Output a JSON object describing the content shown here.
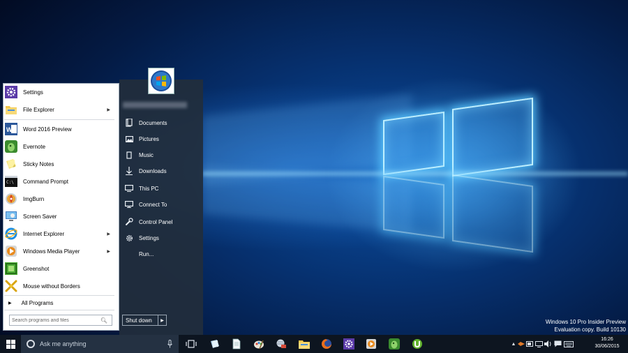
{
  "start_menu": {
    "programs": [
      {
        "label": "Settings",
        "icon": "gear-icon",
        "has_submenu": false
      },
      {
        "label": "File Explorer",
        "icon": "folder-icon",
        "has_submenu": true
      },
      {
        "label": "Word 2016 Preview",
        "icon": "word-icon",
        "has_submenu": false
      },
      {
        "label": "Evernote",
        "icon": "evernote-icon",
        "has_submenu": false
      },
      {
        "label": "Sticky Notes",
        "icon": "sticky-notes-icon",
        "has_submenu": false
      },
      {
        "label": "Command Prompt",
        "icon": "command-prompt-icon",
        "has_submenu": false
      },
      {
        "label": "ImgBurn",
        "icon": "imgburn-icon",
        "has_submenu": false
      },
      {
        "label": "Screen Saver",
        "icon": "screen-saver-icon",
        "has_submenu": false
      },
      {
        "label": "Internet Explorer",
        "icon": "internet-explorer-icon",
        "has_submenu": true
      },
      {
        "label": "Windows Media Player",
        "icon": "media-player-icon",
        "has_submenu": true
      },
      {
        "label": "Greenshot",
        "icon": "greenshot-icon",
        "has_submenu": false
      },
      {
        "label": "Mouse without Borders",
        "icon": "mouse-without-borders-icon",
        "has_submenu": false
      }
    ],
    "all_programs_label": "All Programs",
    "search_placeholder": "Search programs and files",
    "right_items": [
      {
        "label": "Documents",
        "icon": "documents-icon"
      },
      {
        "label": "Pictures",
        "icon": "pictures-icon"
      },
      {
        "label": "Music",
        "icon": "music-icon"
      },
      {
        "label": "Downloads",
        "icon": "downloads-icon"
      },
      {
        "label": "This PC",
        "icon": "computer-icon"
      },
      {
        "label": "Connect To",
        "icon": "connect-icon"
      },
      {
        "label": "Control Panel",
        "icon": "control-panel-icon"
      },
      {
        "label": "Settings",
        "icon": "gear-icon"
      },
      {
        "label": "Run...",
        "icon": "run-icon"
      }
    ],
    "shutdown_label": "Shut down"
  },
  "taskbar": {
    "search_label": "Ask me anything",
    "clock_time": "16:26",
    "clock_date": "30/06/2015"
  },
  "watermark": {
    "line1": "Windows 10 Pro Insider Preview",
    "line2": "Evaluation copy. Build 10130"
  },
  "colors": {
    "taskbar": "#0d1520",
    "start_right_panel": "#222e3c",
    "accent": "#1e78d7"
  }
}
